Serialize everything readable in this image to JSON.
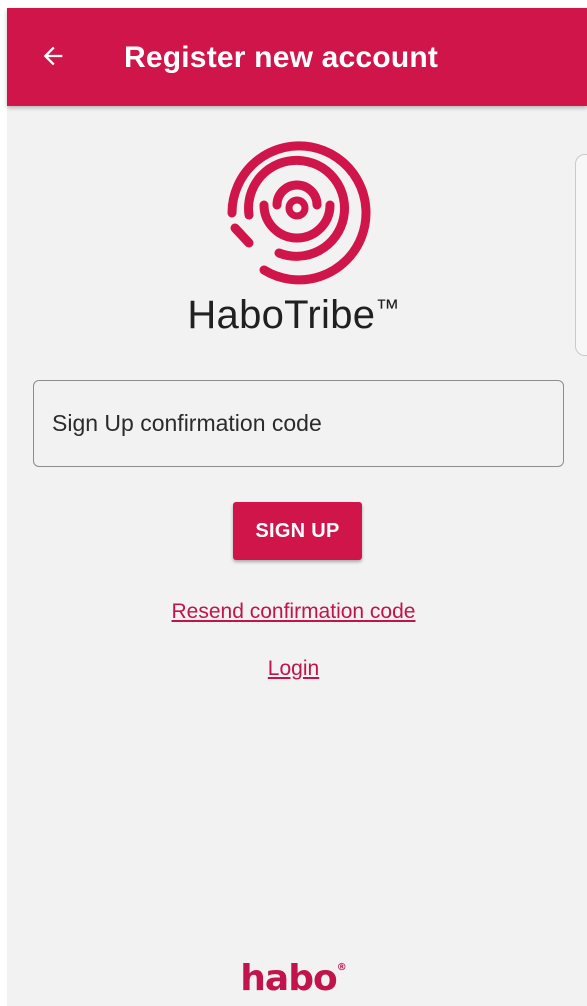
{
  "appbar": {
    "title": "Register new account",
    "back_icon": "arrow-left-icon"
  },
  "brand": {
    "logo_icon": "habotribe-spiral-logo",
    "name": "HaboTribe",
    "trademark": "™"
  },
  "form": {
    "code_placeholder": "Sign Up confirmation code",
    "code_value": "",
    "signup_label": "SIGN UP"
  },
  "links": {
    "resend": "Resend confirmation code",
    "login": "Login"
  },
  "footer": {
    "logo_text": "habo",
    "registered_mark": "®"
  },
  "colors": {
    "primary": "#d0154a",
    "link": "#c0144a",
    "background": "#f2f2f2"
  }
}
